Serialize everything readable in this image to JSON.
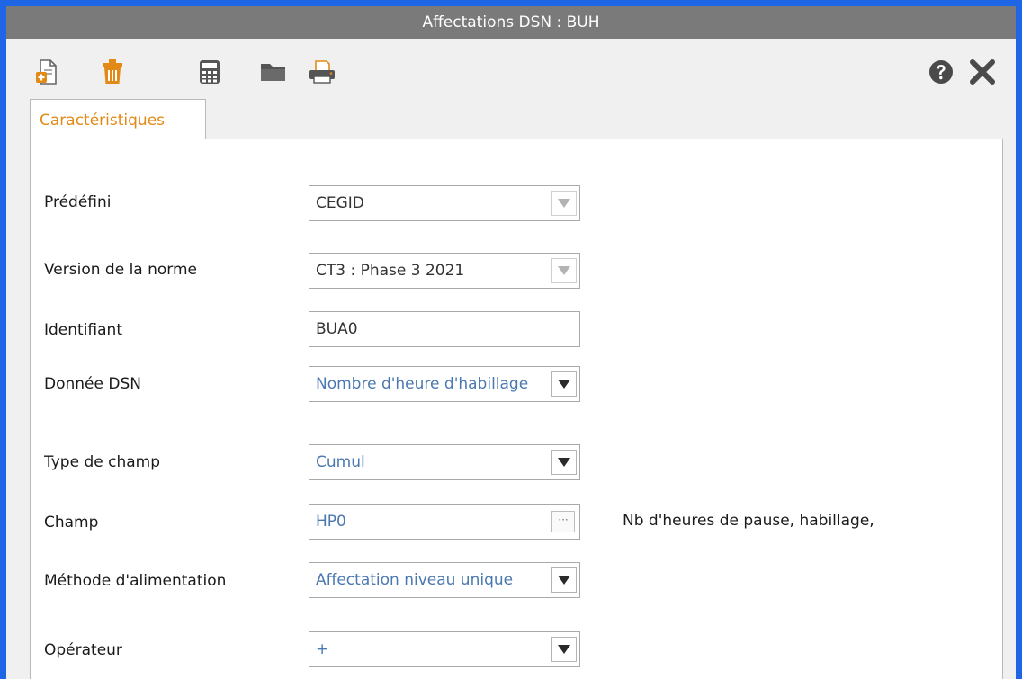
{
  "window": {
    "title": "Affectations DSN :  BUH"
  },
  "toolbar": {
    "buttons": [
      {
        "name": "new-icon"
      },
      {
        "name": "delete-icon"
      },
      {
        "name": "calculator-icon"
      },
      {
        "name": "folder-icon"
      },
      {
        "name": "print-icon"
      },
      {
        "name": "help-icon"
      },
      {
        "name": "close-icon"
      }
    ]
  },
  "tabs": [
    {
      "label": "Caractéristiques",
      "active": true
    }
  ],
  "form": {
    "predefini": {
      "label": "Prédéfini",
      "value": "CEGID"
    },
    "version": {
      "label": "Version de la norme",
      "value": "CT3 : Phase 3 2021"
    },
    "identifiant": {
      "label": "Identifiant",
      "value": "BUA0"
    },
    "donnee": {
      "label": "Donnée DSN",
      "value": "Nombre d'heure d'habillage"
    },
    "type_champ": {
      "label": "Type de champ",
      "value": "Cumul"
    },
    "champ": {
      "label": "Champ",
      "value": "HP0",
      "description": "Nb d'heures de pause, habillage,"
    },
    "methode": {
      "label": "Méthode d'alimentation",
      "value": "Affectation niveau unique"
    },
    "operateur": {
      "label": "Opérateur",
      "value": "+"
    }
  },
  "colors": {
    "accent": "#e38a16",
    "window_border": "#1e66e6",
    "titlebar": "#7a7a7a",
    "field_blue_text": "#4a78b0"
  }
}
